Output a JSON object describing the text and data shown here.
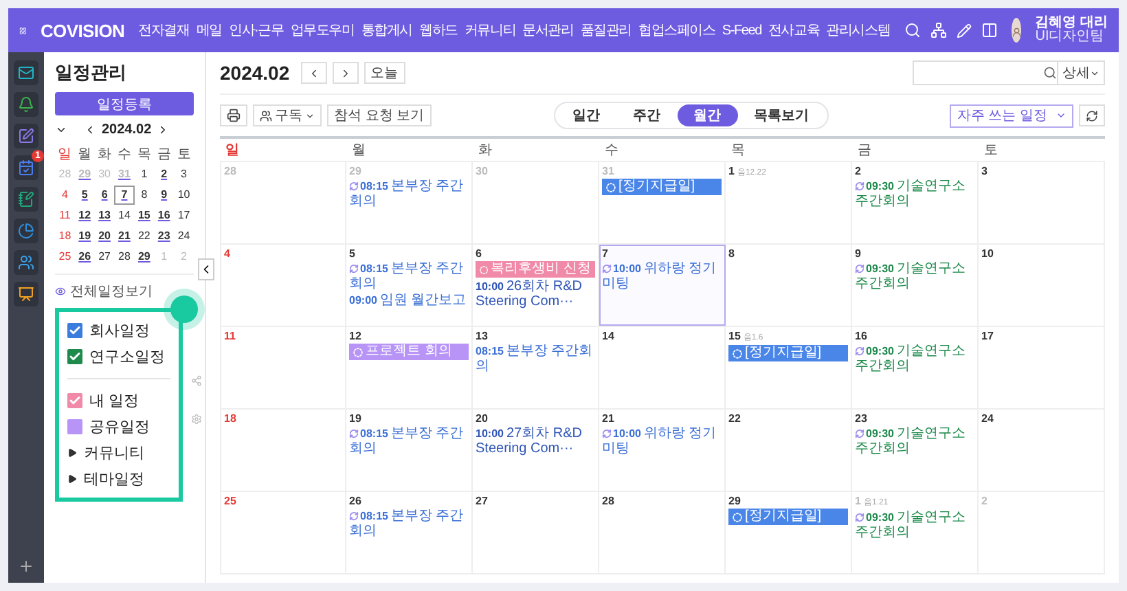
{
  "topbar": {
    "logo": "COVISION",
    "menu": [
      "전자결재",
      "메일",
      "인사·근무",
      "업무도우미",
      "통합게시",
      "웹하드",
      "커뮤니티",
      "문서관리",
      "품질관리",
      "협업스페이스",
      "S-Feed",
      "전사교육",
      "관리시스템"
    ],
    "user": {
      "name": "김혜영 대리",
      "team": "UI디자인팀"
    }
  },
  "rail": {
    "calendar_badge": "1"
  },
  "sidebar": {
    "title": "일정관리",
    "register_button": "일정등록",
    "mini_calendar": {
      "month": "2024.02",
      "weekdays": [
        "일",
        "월",
        "화",
        "수",
        "목",
        "금",
        "토"
      ],
      "weeks": [
        [
          {
            "day": "28",
            "muted": true,
            "event": false,
            "selected": false
          },
          {
            "day": "29",
            "muted": true,
            "event": true,
            "selected": false
          },
          {
            "day": "30",
            "muted": true,
            "event": false,
            "selected": false
          },
          {
            "day": "31",
            "muted": true,
            "event": true,
            "selected": false
          },
          {
            "day": "1",
            "muted": false,
            "event": false,
            "selected": false
          },
          {
            "day": "2",
            "muted": false,
            "event": true,
            "selected": false
          },
          {
            "day": "3",
            "muted": false,
            "event": false,
            "selected": false
          }
        ],
        [
          {
            "day": "4",
            "muted": false,
            "event": false,
            "selected": false
          },
          {
            "day": "5",
            "muted": false,
            "event": true,
            "selected": false
          },
          {
            "day": "6",
            "muted": false,
            "event": true,
            "selected": false
          },
          {
            "day": "7",
            "muted": false,
            "event": true,
            "selected": true
          },
          {
            "day": "8",
            "muted": false,
            "event": false,
            "selected": false
          },
          {
            "day": "9",
            "muted": false,
            "event": true,
            "selected": false
          },
          {
            "day": "10",
            "muted": false,
            "event": false,
            "selected": false
          }
        ],
        [
          {
            "day": "11",
            "muted": false,
            "event": false,
            "selected": false
          },
          {
            "day": "12",
            "muted": false,
            "event": true,
            "selected": false
          },
          {
            "day": "13",
            "muted": false,
            "event": true,
            "selected": false
          },
          {
            "day": "14",
            "muted": false,
            "event": false,
            "selected": false
          },
          {
            "day": "15",
            "muted": false,
            "event": true,
            "selected": false
          },
          {
            "day": "16",
            "muted": false,
            "event": true,
            "selected": false
          },
          {
            "day": "17",
            "muted": false,
            "event": false,
            "selected": false
          }
        ],
        [
          {
            "day": "18",
            "muted": false,
            "event": false,
            "selected": false
          },
          {
            "day": "19",
            "muted": false,
            "event": true,
            "selected": false
          },
          {
            "day": "20",
            "muted": false,
            "event": true,
            "selected": false
          },
          {
            "day": "21",
            "muted": false,
            "event": true,
            "selected": false
          },
          {
            "day": "22",
            "muted": false,
            "event": false,
            "selected": false
          },
          {
            "day": "23",
            "muted": false,
            "event": true,
            "selected": false
          },
          {
            "day": "24",
            "muted": false,
            "event": false,
            "selected": false
          }
        ],
        [
          {
            "day": "25",
            "muted": false,
            "event": false,
            "selected": false
          },
          {
            "day": "26",
            "muted": false,
            "event": true,
            "selected": false
          },
          {
            "day": "27",
            "muted": false,
            "event": false,
            "selected": false
          },
          {
            "day": "28",
            "muted": false,
            "event": false,
            "selected": false
          },
          {
            "day": "29",
            "muted": false,
            "event": true,
            "selected": false
          },
          {
            "day": "1",
            "muted": true,
            "event": false,
            "selected": false
          },
          {
            "day": "2",
            "muted": true,
            "event": false,
            "selected": false
          }
        ]
      ]
    },
    "all_view_link": "전체일정보기",
    "calendars": [
      {
        "kind": "check",
        "label": "회사일정",
        "checked": true,
        "color": "#3b7ddd"
      },
      {
        "kind": "check",
        "label": "연구소일정",
        "checked": true,
        "color": "#1e8a4c"
      },
      {
        "kind": "divider"
      },
      {
        "kind": "check",
        "label": "내 일정",
        "checked": true,
        "color": "#f08aa8"
      },
      {
        "kind": "check",
        "label": "공유일정",
        "checked": false,
        "color": "#b794f6"
      },
      {
        "kind": "group",
        "label": "커뮤니티",
        "expanded": false
      },
      {
        "kind": "group",
        "label": "테마일정",
        "expanded": false
      }
    ]
  },
  "main": {
    "month": "2024.02",
    "today_button": "오늘",
    "detail_button": "상세",
    "subscribe_button": "구독",
    "attend_button": "참석 요청 보기",
    "view_tabs": [
      {
        "label": "일간",
        "selected": false
      },
      {
        "label": "주간",
        "selected": false
      },
      {
        "label": "월간",
        "selected": true
      },
      {
        "label": "목록보기",
        "selected": false
      }
    ],
    "frequent_select": "자주 쓰는 일정",
    "weekdays": [
      "일",
      "월",
      "화",
      "수",
      "목",
      "금",
      "토"
    ],
    "weeks": [
      [
        {
          "day": "28",
          "muted": true,
          "selected": false
        },
        {
          "day": "29",
          "muted": true,
          "selected": false,
          "events": [
            {
              "kind": "entry",
              "recurring": true,
              "time": "08:15",
              "title": "본부장 주간회의",
              "color": "#3b6fd6"
            }
          ]
        },
        {
          "day": "30",
          "muted": true,
          "selected": false
        },
        {
          "day": "31",
          "muted": true,
          "selected": false,
          "events": [
            {
              "kind": "bar",
              "title": "[정기지급일]",
              "color": "#4a86e8"
            }
          ]
        },
        {
          "day": "1",
          "lunar": "음12.22",
          "muted": false,
          "selected": false
        },
        {
          "day": "2",
          "muted": false,
          "selected": false,
          "events": [
            {
              "kind": "entry",
              "recurring": true,
              "time": "09:30",
              "title": "기술연구소 주간회의",
              "color": "#1e8a4c"
            }
          ]
        },
        {
          "day": "3",
          "muted": false,
          "selected": false
        }
      ],
      [
        {
          "day": "4",
          "muted": false,
          "selected": false
        },
        {
          "day": "5",
          "muted": false,
          "selected": false,
          "events": [
            {
              "kind": "entry",
              "recurring": true,
              "time": "08:15",
              "title": "본부장 주간회의",
              "color": "#3b6fd6"
            },
            {
              "kind": "entry",
              "recurring": false,
              "time": "09:00",
              "title": "임원 월간보고",
              "color": "#3b6fd6"
            }
          ]
        },
        {
          "day": "6",
          "muted": false,
          "selected": false,
          "events": [
            {
              "kind": "bar",
              "title": "복리후생비 신청",
              "color": "#f08aa8"
            },
            {
              "kind": "entry",
              "recurring": false,
              "time": "10:00",
              "title": "26회차 R&D Steering Com···",
              "color": "#2f55b8"
            }
          ]
        },
        {
          "day": "7",
          "muted": false,
          "selected": true,
          "events": [
            {
              "kind": "entry",
              "recurring": true,
              "time": "10:00",
              "title": "위하랑 정기 미팅",
              "color": "#3b6fd6"
            }
          ]
        },
        {
          "day": "8",
          "muted": false,
          "selected": false
        },
        {
          "day": "9",
          "muted": false,
          "selected": false,
          "events": [
            {
              "kind": "entry",
              "recurring": true,
              "time": "09:30",
              "title": "기술연구소 주간회의",
              "color": "#1e8a4c"
            }
          ]
        },
        {
          "day": "10",
          "muted": false,
          "selected": false
        }
      ],
      [
        {
          "day": "11",
          "muted": false,
          "selected": false
        },
        {
          "day": "12",
          "muted": false,
          "selected": false,
          "events": [
            {
              "kind": "bar",
              "title": "프로젝트 회의",
              "color": "#b794f6"
            }
          ]
        },
        {
          "day": "13",
          "muted": false,
          "selected": false,
          "events": [
            {
              "kind": "entry",
              "recurring": false,
              "time": "08:15",
              "title": "본부장 주간회의",
              "color": "#3b6fd6"
            }
          ]
        },
        {
          "day": "14",
          "muted": false,
          "selected": false
        },
        {
          "day": "15",
          "lunar": "음1.6",
          "muted": false,
          "selected": false,
          "events": [
            {
              "kind": "bar",
              "title": "[정기지급일]",
              "color": "#4a86e8"
            }
          ]
        },
        {
          "day": "16",
          "muted": false,
          "selected": false,
          "events": [
            {
              "kind": "entry",
              "recurring": true,
              "time": "09:30",
              "title": "기술연구소 주간회의",
              "color": "#1e8a4c"
            }
          ]
        },
        {
          "day": "17",
          "muted": false,
          "selected": false
        }
      ],
      [
        {
          "day": "18",
          "muted": false,
          "selected": false
        },
        {
          "day": "19",
          "muted": false,
          "selected": false,
          "events": [
            {
              "kind": "entry",
              "recurring": true,
              "time": "08:15",
              "title": "본부장 주간회의",
              "color": "#3b6fd6"
            }
          ]
        },
        {
          "day": "20",
          "muted": false,
          "selected": false,
          "events": [
            {
              "kind": "entry",
              "recurring": false,
              "time": "10:00",
              "title": "27회차 R&D Steering Com···",
              "color": "#2f55b8"
            }
          ]
        },
        {
          "day": "21",
          "muted": false,
          "selected": false,
          "events": [
            {
              "kind": "entry",
              "recurring": true,
              "time": "10:00",
              "title": "위하랑 정기 미팅",
              "color": "#3b6fd6"
            }
          ]
        },
        {
          "day": "22",
          "muted": false,
          "selected": false
        },
        {
          "day": "23",
          "muted": false,
          "selected": false,
          "events": [
            {
              "kind": "entry",
              "recurring": true,
              "time": "09:30",
              "title": "기술연구소 주간회의",
              "color": "#1e8a4c"
            }
          ]
        },
        {
          "day": "24",
          "muted": false,
          "selected": false
        }
      ],
      [
        {
          "day": "25",
          "muted": false,
          "selected": false
        },
        {
          "day": "26",
          "muted": false,
          "selected": false,
          "events": [
            {
              "kind": "entry",
              "recurring": true,
              "time": "08:15",
              "title": "본부장 주간회의",
              "color": "#3b6fd6"
            }
          ]
        },
        {
          "day": "27",
          "muted": false,
          "selected": false
        },
        {
          "day": "28",
          "muted": false,
          "selected": false
        },
        {
          "day": "29",
          "muted": false,
          "selected": false,
          "events": [
            {
              "kind": "bar",
              "title": "[정기지급일]",
              "color": "#4a86e8"
            }
          ]
        },
        {
          "day": "1",
          "lunar": "음1.21",
          "muted": true,
          "selected": false,
          "events": [
            {
              "kind": "entry",
              "recurring": true,
              "time": "09:30",
              "title": "기술연구소 주간회의",
              "color": "#1e8a4c"
            }
          ]
        },
        {
          "day": "2",
          "muted": true,
          "selected": false
        }
      ]
    ]
  }
}
